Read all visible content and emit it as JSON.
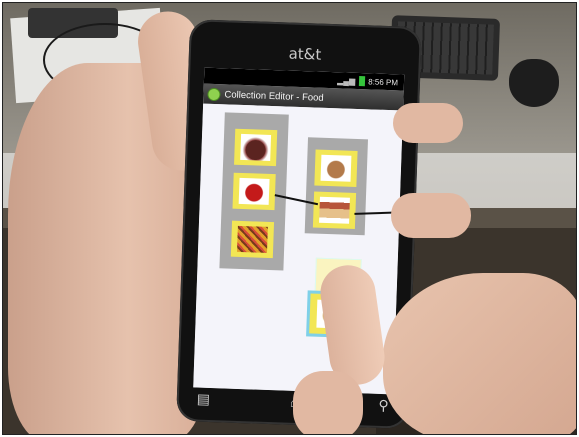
{
  "photo": {
    "description_scene": "hands-holding-phone",
    "colors": {
      "tile_yellow": "#f2e655",
      "stack_gray": "#a9a9a9",
      "selection_blue": "#7fd0e8",
      "title_bar": "#2e2e2e"
    }
  },
  "phone": {
    "brand": "at&t",
    "status_time": "8:56 PM",
    "app_title": "Collection Editor - Food",
    "nav": {
      "menu_icon": "▤",
      "home_icon": "⌂",
      "search_icon": "⚲"
    }
  },
  "collections": [
    {
      "items": [
        "chocolate-icon",
        "apple-icon",
        "candy-icon"
      ]
    },
    {
      "items": [
        "muffin-icon",
        "pie-icon"
      ]
    }
  ],
  "dragging_item": "cookie-icon"
}
